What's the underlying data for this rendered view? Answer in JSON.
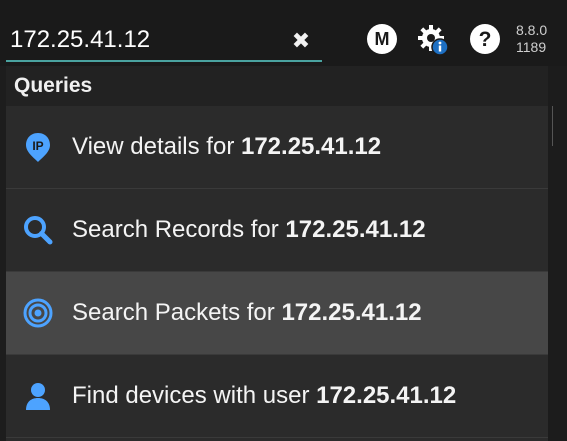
{
  "search": {
    "value": "172.25.41.12",
    "clear_icon": "close-icon"
  },
  "header_icons": {
    "m": "M",
    "gear": "gear-info-icon",
    "help": "?"
  },
  "version": {
    "number": "8.8.0",
    "build": "1189"
  },
  "dropdown": {
    "section": "Queries",
    "items": [
      {
        "prefix": "View details for ",
        "ip": "172.25.41.12",
        "icon": "ip-pin-icon"
      },
      {
        "prefix": "Search Records for ",
        "ip": "172.25.41.12",
        "icon": "search-icon"
      },
      {
        "prefix": "Search Packets for ",
        "ip": "172.25.41.12",
        "icon": "target-icon",
        "highlighted": true
      },
      {
        "prefix": "Find devices with user ",
        "ip": "172.25.41.12",
        "icon": "user-icon"
      }
    ]
  },
  "colors": {
    "accent": "#4da3ff",
    "underline": "#4aa3a0",
    "highlight_row": "#474747"
  }
}
